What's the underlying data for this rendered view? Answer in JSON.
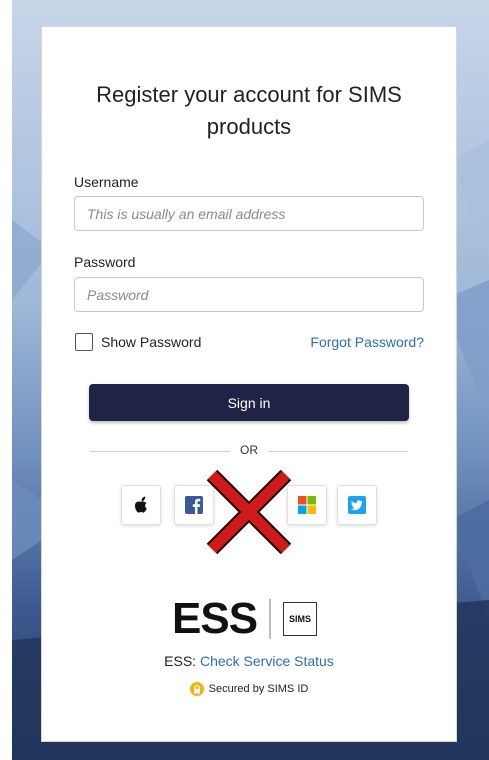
{
  "title": "Register your account for SIMS products",
  "username": {
    "label": "Username",
    "placeholder": "This is usually an email address"
  },
  "password": {
    "label": "Password",
    "placeholder": "Password"
  },
  "show_password_label": "Show Password",
  "forgot_password_label": "Forgot Password?",
  "signin_label": "Sign in",
  "or_label": "OR",
  "social_buttons": [
    "apple-icon",
    "facebook-icon",
    "microsoft-icon",
    "twitter-icon"
  ],
  "logo": {
    "ess": "ESS",
    "sims": "SIMS"
  },
  "status": {
    "prefix": "ESS:",
    "link": "Check Service Status"
  },
  "secured_label": "Secured by SIMS ID",
  "colors": {
    "button": "#1f2447",
    "link": "#2d6fa8",
    "cross": "#d11a1a"
  }
}
